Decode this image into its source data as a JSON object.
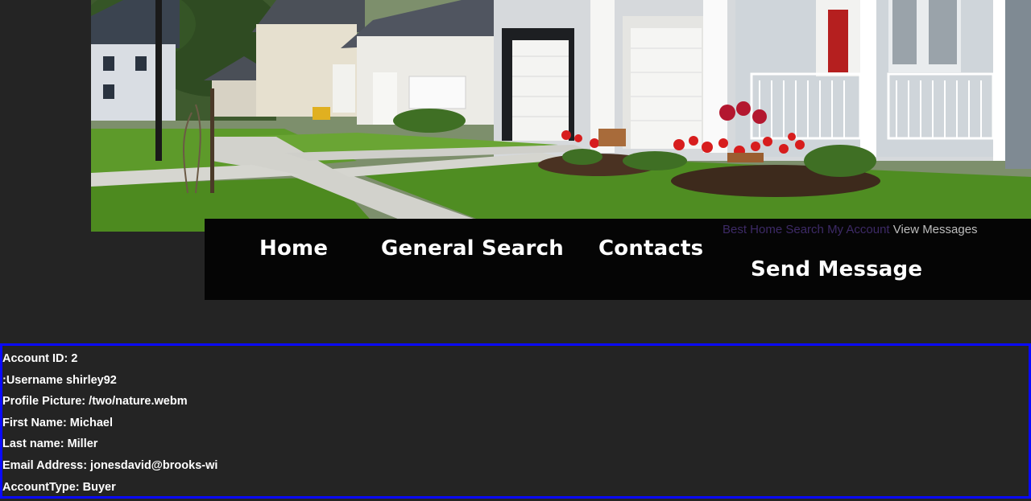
{
  "nav": {
    "items": [
      {
        "label": "Home"
      },
      {
        "label": "General Search"
      },
      {
        "label": "Contacts"
      },
      {
        "label": "Send Message"
      }
    ]
  },
  "text_links": {
    "best_home_search": "Best Home Search",
    "my_account": "My Account",
    "view_messages": "View Messages"
  },
  "account": {
    "rows": [
      "Account ID: 2",
      ":Username shirley92",
      "Profile Picture: /two/nature.webm",
      "First Name: Michael",
      "Last name: Miller",
      "Email Address: jonesdavid@brooks-wi",
      "AccountType: Buyer"
    ]
  },
  "colors": {
    "background": "#242424",
    "navbar": "#050505",
    "panel_border": "#0a0aff",
    "dim_link": "#3d2a66",
    "lit_link": "#bdbdbd"
  }
}
